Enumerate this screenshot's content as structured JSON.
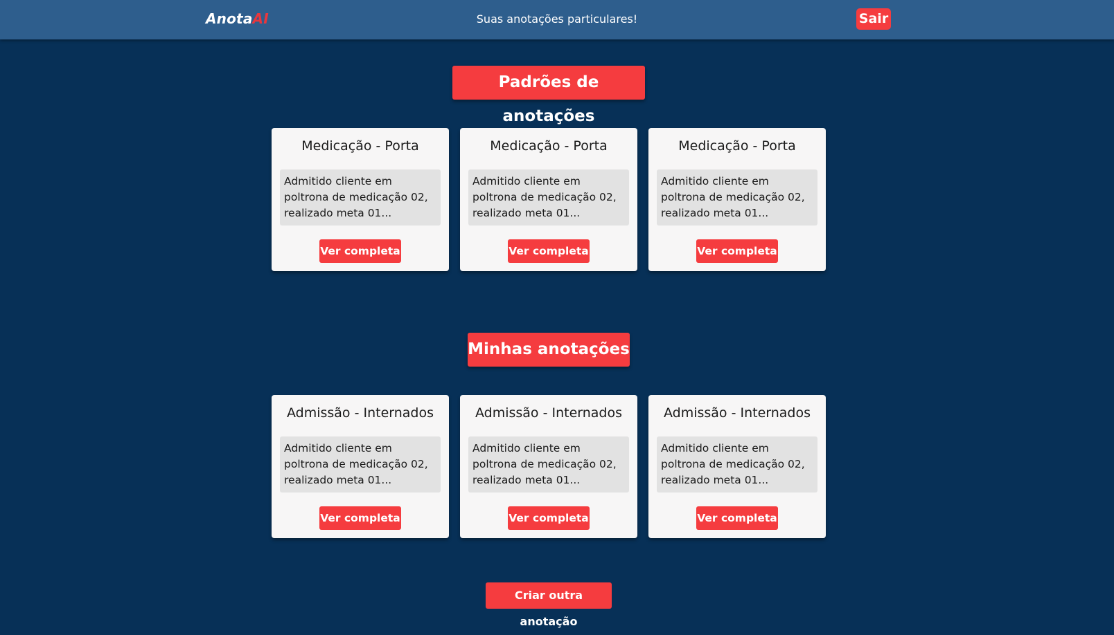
{
  "header": {
    "logo_main": "Anota",
    "logo_accent": "AI",
    "tagline": "Suas anotações particulares!",
    "logout_label": "Sair"
  },
  "templates_section": {
    "title": "Padrões de anotações",
    "cards": [
      {
        "title": "Medicação - Porta",
        "preview": "Admitido cliente em poltrona de medicação 02, realizado meta 01...",
        "button": "Ver completa"
      },
      {
        "title": "Medicação - Porta",
        "preview": "Admitido cliente em poltrona de medicação 02, realizado meta 01...",
        "button": "Ver completa"
      },
      {
        "title": "Medicação - Porta",
        "preview": "Admitido cliente em poltrona de medicação 02, realizado meta 01...",
        "button": "Ver completa"
      }
    ]
  },
  "my_notes_section": {
    "title": "Minhas anotações",
    "cards": [
      {
        "title": "Admissão - Internados",
        "preview": "Admitido cliente em poltrona de medicação 02, realizado meta 01...",
        "button": "Ver completa"
      },
      {
        "title": "Admissão - Internados",
        "preview": "Admitido cliente em poltrona de medicação 02, realizado meta 01...",
        "button": "Ver completa"
      },
      {
        "title": "Admissão - Internados",
        "preview": "Admitido cliente em poltrona de medicação 02, realizado meta 01...",
        "button": "Ver completa"
      }
    ]
  },
  "create_button_label": "Criar outra anotação",
  "colors": {
    "background": "#073057",
    "header": "#2e5e8d",
    "accent": "#f53c3f",
    "card": "#f7f6f6",
    "card_body": "#e2e2e2"
  }
}
